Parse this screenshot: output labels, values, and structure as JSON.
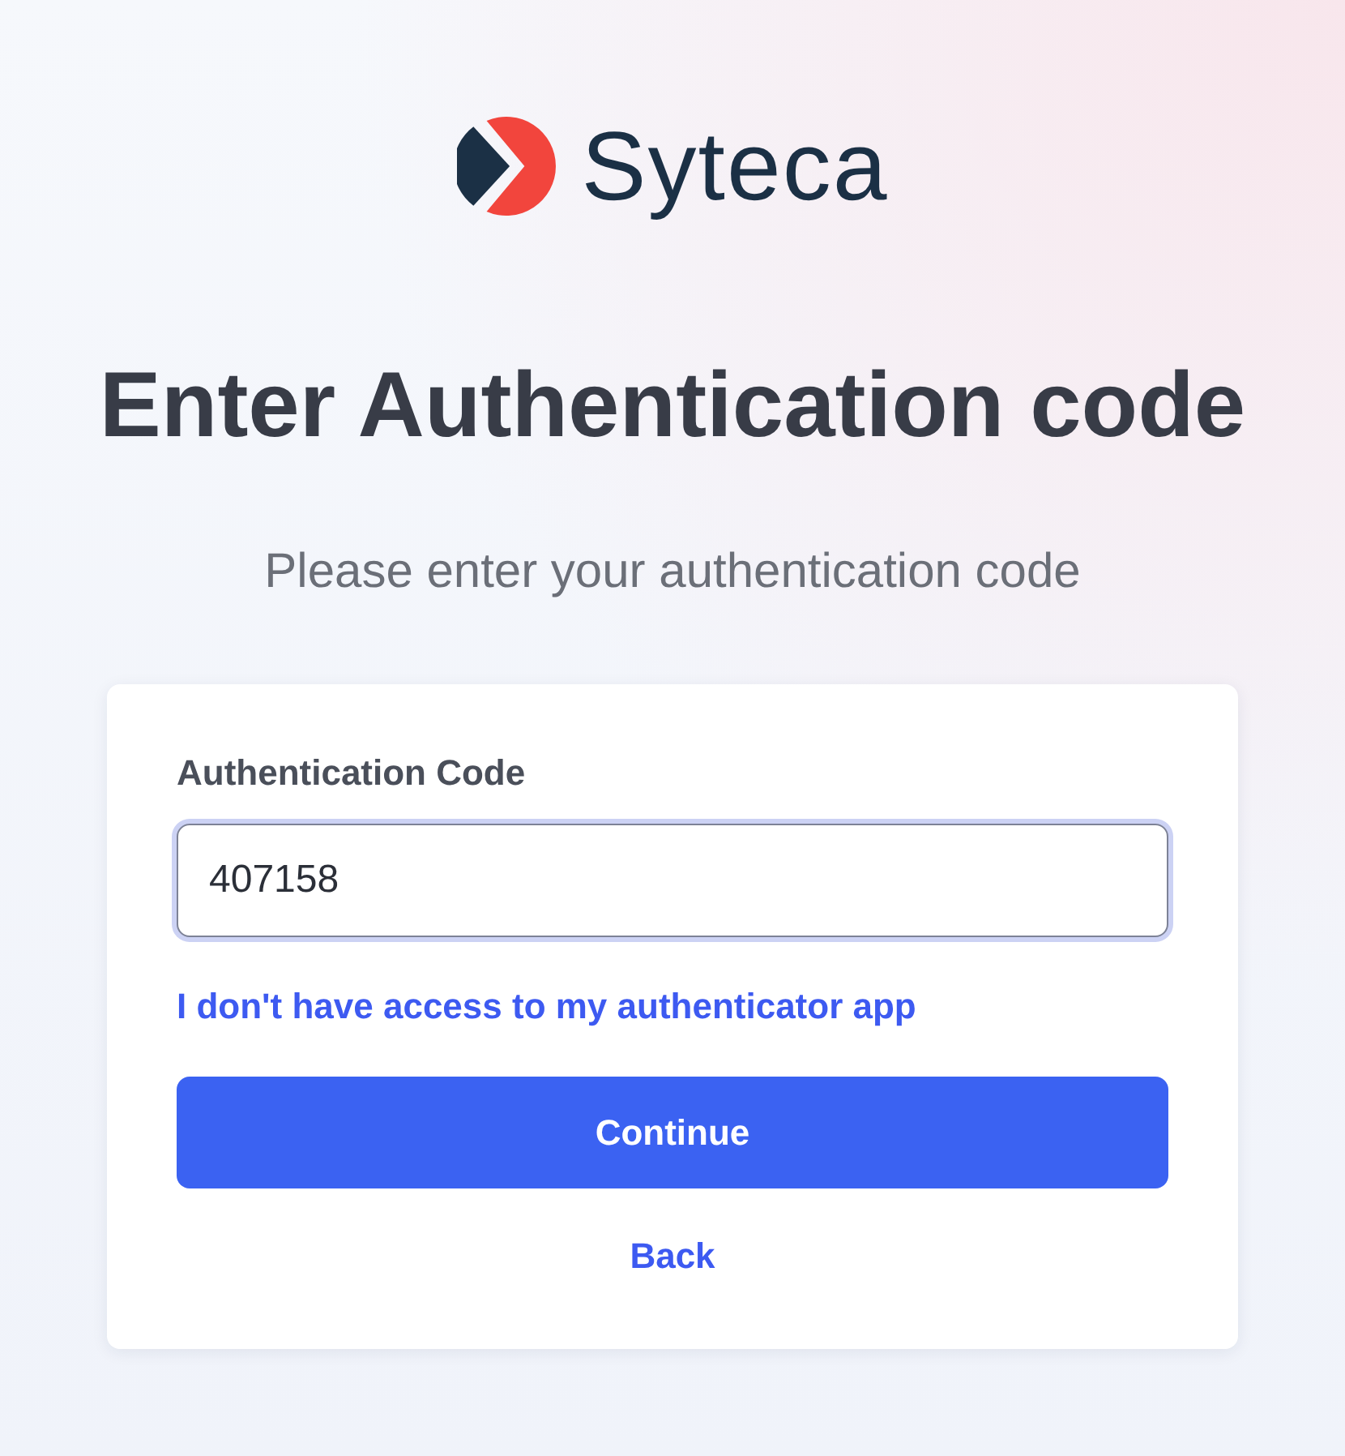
{
  "logo": {
    "wordmark": "Syteca"
  },
  "heading": {
    "title": "Enter Authentication code",
    "subtitle": "Please enter your authentication code"
  },
  "form": {
    "field": {
      "label": "Authentication Code",
      "value": "407158",
      "focused": true
    },
    "help_link": "I don't have access to my authenticator app",
    "primary_button": "Continue",
    "secondary_link": "Back"
  }
}
